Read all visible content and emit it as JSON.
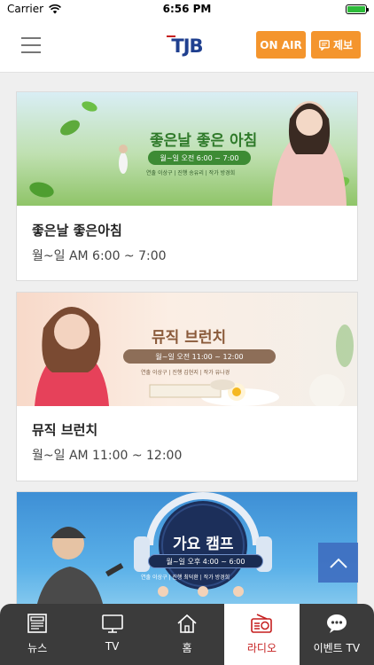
{
  "status_bar": {
    "carrier": "Carrier",
    "time": "6:56 PM"
  },
  "header": {
    "logo_text": "TJB",
    "onair_label": "ON AIR",
    "report_label": "제보"
  },
  "programs": [
    {
      "title": "좋은날 좋은아침",
      "time": "월~일 AM 6:00 ~ 7:00",
      "banner": {
        "title": "좋은날 좋은 아침",
        "schedule": "월~일 오전 6:00 ~ 7:00",
        "credits": "연출 이상구 | 진행 송유리 | 작가 방경희"
      }
    },
    {
      "title": "뮤직 브런치",
      "time": "월~일 AM 11:00 ~ 12:00",
      "banner": {
        "title": "뮤직 브런치",
        "schedule": "월~일 오전 11:00 ~ 12:00",
        "credits": "연출 이상구 | 진행 김현지 | 작가 유나경"
      }
    },
    {
      "title": "가요 캠프",
      "time": "",
      "banner": {
        "title": "가요 캠프",
        "schedule": "월~일 오후 4:00 ~ 6:00",
        "credits": "연출 이상구 | 진행 최덕환 | 작가 방경희"
      }
    }
  ],
  "tabs": [
    {
      "label": "뉴스",
      "icon": "news-icon",
      "active": false
    },
    {
      "label": "TV",
      "icon": "tv-icon",
      "active": false
    },
    {
      "label": "홈",
      "icon": "home-icon",
      "active": false
    },
    {
      "label": "라디오",
      "icon": "radio-icon",
      "active": true
    },
    {
      "label": "이벤트 TV",
      "icon": "event-tv-icon",
      "active": false
    }
  ],
  "colors": {
    "accent": "#f4952d",
    "logo_blue": "#1f3f8f",
    "active_tab_text": "#c51e1e",
    "tabbar_bg": "#3b3b3b",
    "scroll_top_bg": "#3f6fc1"
  }
}
